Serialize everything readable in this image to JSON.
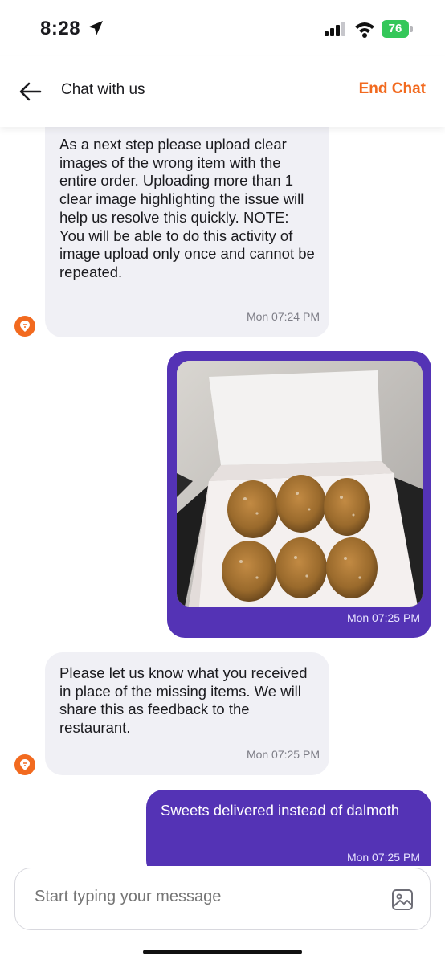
{
  "status_bar": {
    "time": "8:28",
    "battery": "76"
  },
  "header": {
    "title": "Chat with us",
    "end_chat_label": "End Chat"
  },
  "messages": [
    {
      "from": "agent",
      "text": "As a next step please upload clear images of the wrong item with the entire order. Uploading more than 1 clear image highlighting the issue will help us resolve this quickly. NOTE: You will be able to do this activity of image upload only once and cannot be repeated.",
      "time": "Mon 07:24 PM"
    },
    {
      "from": "user",
      "type": "image",
      "time": "Mon 07:25 PM"
    },
    {
      "from": "agent",
      "text": "Please let us know what you received in place of the missing items. We will share this as feedback to the restaurant.",
      "time": "Mon 07:25 PM"
    },
    {
      "from": "user",
      "text": "Sweets delivered instead of dalmoth",
      "time": "Mon 07:25 PM"
    }
  ],
  "composer": {
    "placeholder": "Start typing your message"
  },
  "colors": {
    "accent": "#f26a1f",
    "user_bubble": "#5433b5",
    "agent_bubble": "#f0f0f5"
  }
}
